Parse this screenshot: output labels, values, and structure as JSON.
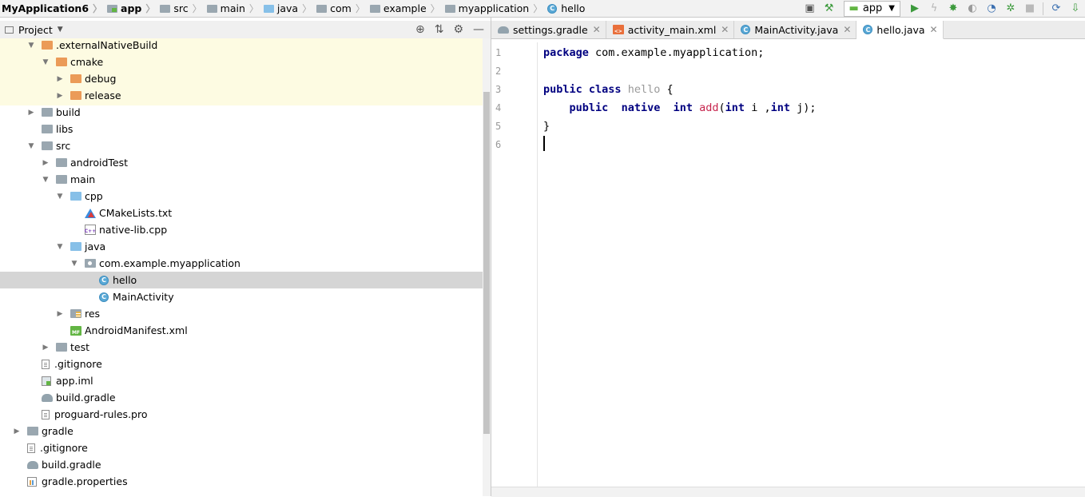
{
  "breadcrumbs": [
    {
      "label": "MyApplication6",
      "icon": "none",
      "bold": true
    },
    {
      "label": "app",
      "icon": "module-icon",
      "bold": true
    },
    {
      "label": "src",
      "icon": "folder-icon",
      "bold": false
    },
    {
      "label": "main",
      "icon": "folder-icon",
      "bold": false
    },
    {
      "label": "java",
      "icon": "folder-blue-icon",
      "bold": false
    },
    {
      "label": "com",
      "icon": "folder-icon",
      "bold": false
    },
    {
      "label": "example",
      "icon": "folder-icon",
      "bold": false
    },
    {
      "label": "myapplication",
      "icon": "folder-icon",
      "bold": false
    },
    {
      "label": "hello",
      "icon": "class-icon",
      "bold": false
    }
  ],
  "toolbar": {
    "run_config": "app",
    "buttons": [
      "terminal-icon",
      "hammer-icon",
      "run-icon",
      "apply-changes-icon",
      "debug-icon",
      "coverage-icon",
      "profile-icon",
      "attach-debugger-icon",
      "stop-icon",
      "sync-icon",
      "sdk-manager-icon"
    ]
  },
  "project_panel": {
    "title": "Project",
    "tools": [
      "locate-icon",
      "collapse-icon",
      "gear-icon",
      "minimize-icon"
    ]
  },
  "tree": [
    {
      "label": ".externalNativeBuild",
      "depth": 2,
      "arrow": "open",
      "icon": "folder-orange",
      "highlight": true
    },
    {
      "label": "cmake",
      "depth": 3,
      "arrow": "open",
      "icon": "folder-orange",
      "highlight": true
    },
    {
      "label": "debug",
      "depth": 4,
      "arrow": "closed",
      "icon": "folder-orange",
      "highlight": true
    },
    {
      "label": "release",
      "depth": 4,
      "arrow": "closed",
      "icon": "folder-orange",
      "highlight": true
    },
    {
      "label": "build",
      "depth": 2,
      "arrow": "closed",
      "icon": "folder-gray"
    },
    {
      "label": "libs",
      "depth": 2,
      "arrow": "none",
      "icon": "folder-gray"
    },
    {
      "label": "src",
      "depth": 2,
      "arrow": "open",
      "icon": "folder-gray"
    },
    {
      "label": "androidTest",
      "depth": 3,
      "arrow": "closed",
      "icon": "folder-gray"
    },
    {
      "label": "main",
      "depth": 3,
      "arrow": "open",
      "icon": "folder-gray"
    },
    {
      "label": "cpp",
      "depth": 4,
      "arrow": "open",
      "icon": "folder-blue"
    },
    {
      "label": "CMakeLists.txt",
      "depth": 5,
      "arrow": "none",
      "icon": "file-cmake"
    },
    {
      "label": "native-lib.cpp",
      "depth": 5,
      "arrow": "none",
      "icon": "file-cpp"
    },
    {
      "label": "java",
      "depth": 4,
      "arrow": "open",
      "icon": "folder-blue"
    },
    {
      "label": "com.example.myapplication",
      "depth": 5,
      "arrow": "open",
      "icon": "folder-pkg"
    },
    {
      "label": "hello",
      "depth": 6,
      "arrow": "none",
      "icon": "class",
      "selected": true
    },
    {
      "label": "MainActivity",
      "depth": 6,
      "arrow": "none",
      "icon": "class"
    },
    {
      "label": "res",
      "depth": 4,
      "arrow": "closed",
      "icon": "folder-res"
    },
    {
      "label": "AndroidManifest.xml",
      "depth": 4,
      "arrow": "none",
      "icon": "file-mf"
    },
    {
      "label": "test",
      "depth": 3,
      "arrow": "closed",
      "icon": "folder-gray"
    },
    {
      "label": ".gitignore",
      "depth": 2,
      "arrow": "none",
      "icon": "file-doc"
    },
    {
      "label": "app.iml",
      "depth": 2,
      "arrow": "none",
      "icon": "file-iml"
    },
    {
      "label": "build.gradle",
      "depth": 2,
      "arrow": "none",
      "icon": "file-gradle"
    },
    {
      "label": "proguard-rules.pro",
      "depth": 2,
      "arrow": "none",
      "icon": "file-doc"
    },
    {
      "label": "gradle",
      "depth": 1,
      "arrow": "closed",
      "icon": "folder-gray"
    },
    {
      "label": ".gitignore",
      "depth": 1,
      "arrow": "none",
      "icon": "file-doc"
    },
    {
      "label": "build.gradle",
      "depth": 1,
      "arrow": "none",
      "icon": "file-gradle"
    },
    {
      "label": "gradle.properties",
      "depth": 1,
      "arrow": "none",
      "icon": "file-props"
    }
  ],
  "tabs": [
    {
      "label": "settings.gradle",
      "icon": "gradle",
      "active": false
    },
    {
      "label": "activity_main.xml",
      "icon": "xml",
      "active": false
    },
    {
      "label": "MainActivity.java",
      "icon": "class",
      "active": false
    },
    {
      "label": "hello.java",
      "icon": "class",
      "active": true
    }
  ],
  "editor": {
    "line_numbers": [
      "1",
      "2",
      "3",
      "4",
      "5",
      "6"
    ],
    "lines": [
      [
        {
          "t": "package",
          "c": "kw"
        },
        {
          "t": " com.example.myapplication;",
          "c": ""
        }
      ],
      [],
      [
        {
          "t": "public",
          "c": "kw"
        },
        {
          "t": " ",
          "c": ""
        },
        {
          "t": "class",
          "c": "kw"
        },
        {
          "t": " ",
          "c": ""
        },
        {
          "t": "hello",
          "c": "gray"
        },
        {
          "t": " {",
          "c": ""
        }
      ],
      [
        {
          "t": "    ",
          "c": ""
        },
        {
          "t": "public",
          "c": "kw"
        },
        {
          "t": "  ",
          "c": ""
        },
        {
          "t": "native",
          "c": "kw"
        },
        {
          "t": "  ",
          "c": ""
        },
        {
          "t": "int",
          "c": "kw"
        },
        {
          "t": " ",
          "c": ""
        },
        {
          "t": "add",
          "c": "fn"
        },
        {
          "t": "(",
          "c": ""
        },
        {
          "t": "int",
          "c": "kw"
        },
        {
          "t": " i ,",
          "c": ""
        },
        {
          "t": "int",
          "c": "kw"
        },
        {
          "t": " j);",
          "c": ""
        }
      ],
      [
        {
          "t": "}",
          "c": ""
        }
      ],
      []
    ],
    "caret_line": 6
  }
}
